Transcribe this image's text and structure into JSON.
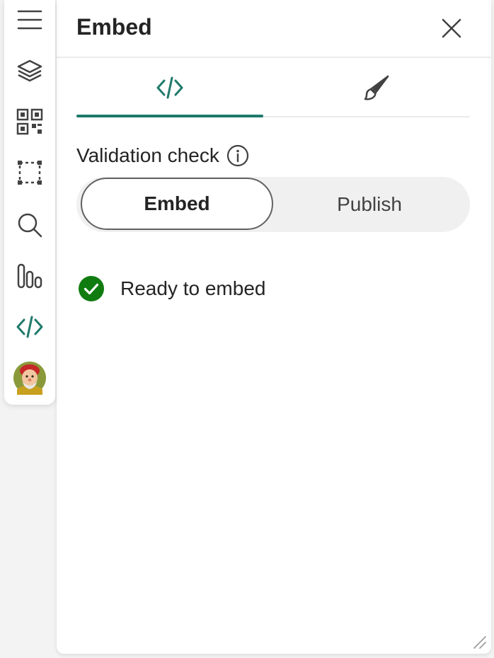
{
  "colors": {
    "accent": "#1f7a6b",
    "success": "#107c10",
    "icon": "#424242"
  },
  "rail": {
    "items": [
      {
        "icon": "hamburger-menu-icon"
      },
      {
        "icon": "layers-icon"
      },
      {
        "icon": "qr-code-icon"
      },
      {
        "icon": "selection-box-icon"
      },
      {
        "icon": "search-icon"
      },
      {
        "icon": "analytics-icon"
      },
      {
        "icon": "code-icon",
        "active": true
      },
      {
        "icon": "user-avatar"
      }
    ]
  },
  "panel": {
    "title": "Embed",
    "tabs": [
      {
        "icon": "code-icon",
        "selected": true
      },
      {
        "icon": "paintbrush-icon",
        "selected": false
      }
    ],
    "validation": {
      "label": "Validation check",
      "options": [
        "Embed",
        "Publish"
      ],
      "selected": "Embed"
    },
    "status": {
      "text": "Ready to embed",
      "icon": "checkmark-circle-icon"
    }
  }
}
